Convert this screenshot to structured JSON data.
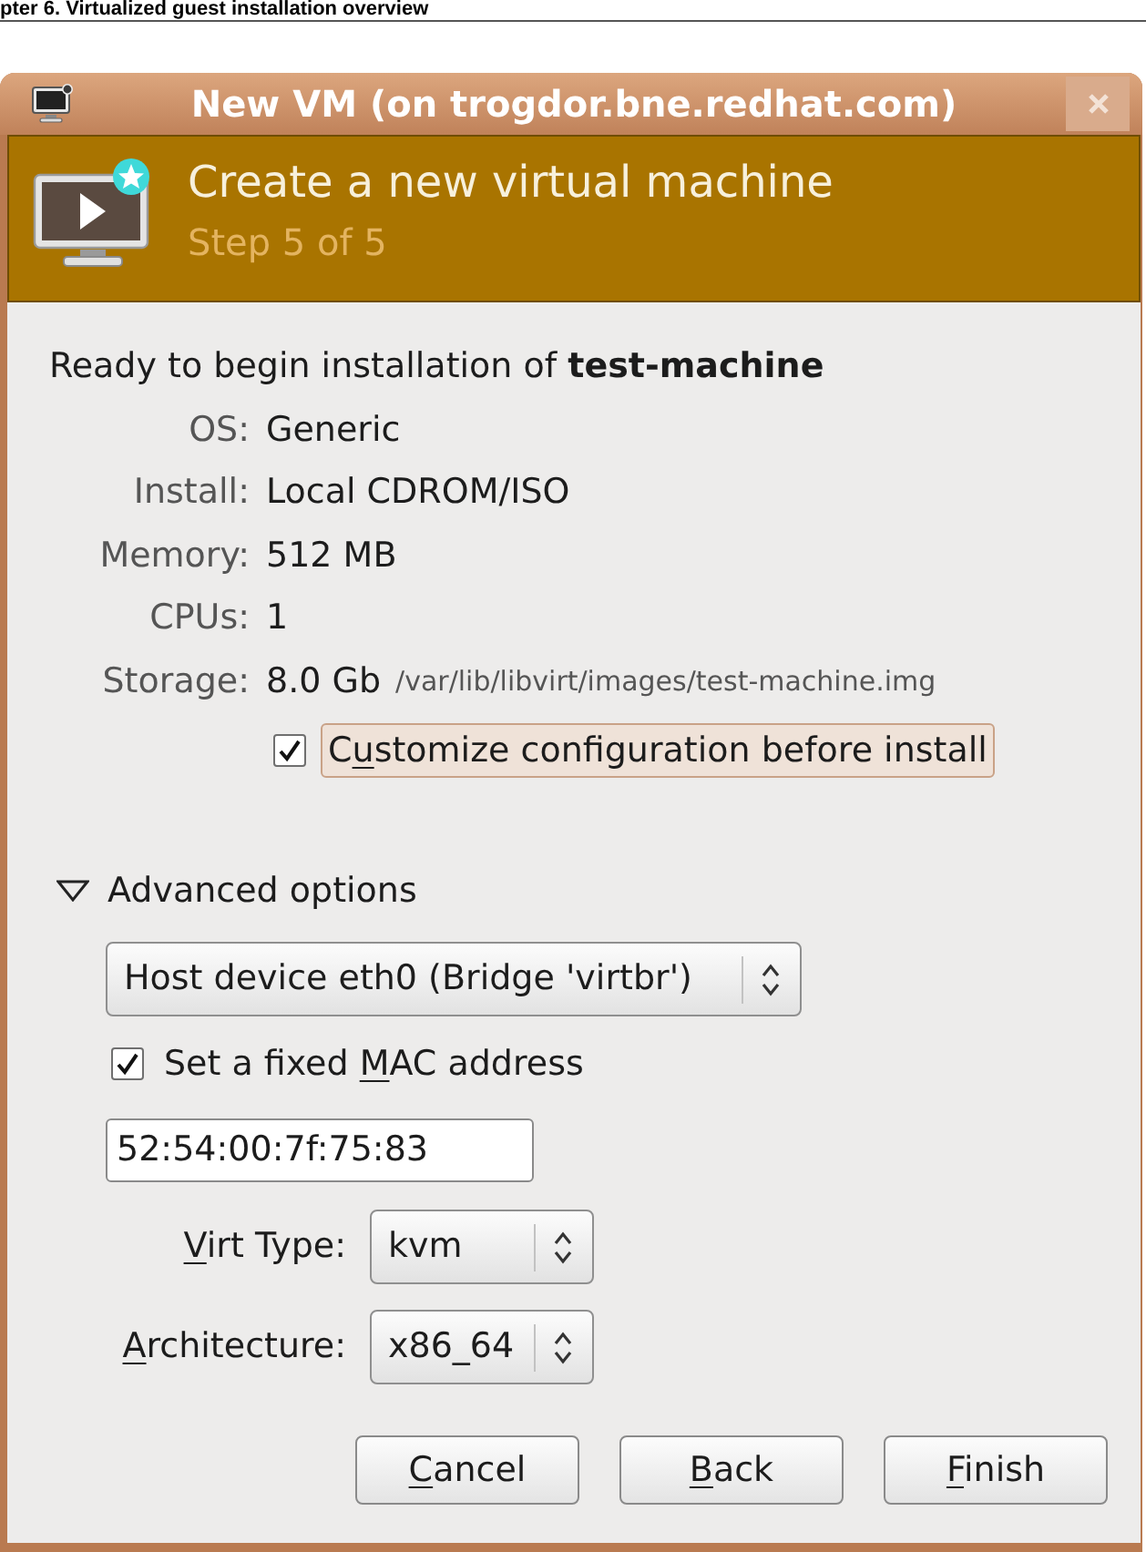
{
  "page_header": "pter 6. Virtualized guest installation overview",
  "window": {
    "title": "New VM (on trogdor.bne.redhat.com)"
  },
  "banner": {
    "title": "Create a new virtual machine",
    "step": "Step 5 of 5"
  },
  "summary": {
    "intro": "Ready to begin installation of **test-machine**",
    "rows": [
      {
        "label": "OS:",
        "value": "Generic"
      },
      {
        "label": "Install:",
        "value": "Local CDROM/ISO"
      },
      {
        "label": "Memory:",
        "value": "512 MB"
      },
      {
        "label": "CPUs:",
        "value": "1"
      },
      {
        "label": "Storage:",
        "value": "8.0 Gb",
        "detail": "/var/lib/libvirt/images/test-machine.img"
      }
    ]
  },
  "customize": {
    "checked": true,
    "hovered": true,
    "label": {
      "before": "C",
      "key": "u",
      "after": "stomize configuration before install"
    }
  },
  "advanced": {
    "label": "Advanced options",
    "expanded": true,
    "network": {
      "value": "Host device eth0 (Bridge 'virtbr')"
    },
    "fixed_mac": {
      "checked": true,
      "label": {
        "before": "Set a fixed ",
        "key": "M",
        "after": "AC address"
      }
    },
    "mac_address": {
      "value": "52:54:00:7f:75:83"
    },
    "fields": [
      {
        "label": {
          "key": "V",
          "after": "irt Type:"
        },
        "value": "kvm"
      },
      {
        "label": {
          "key": "A",
          "after": "rchitecture:"
        },
        "value": "x86_64"
      }
    ]
  },
  "buttons": [
    {
      "label": {
        "key": "C",
        "after": "ancel"
      }
    },
    {
      "label": {
        "key": "B",
        "after": "ack"
      }
    },
    {
      "label": {
        "key": "F",
        "after": "inish"
      }
    }
  ]
}
